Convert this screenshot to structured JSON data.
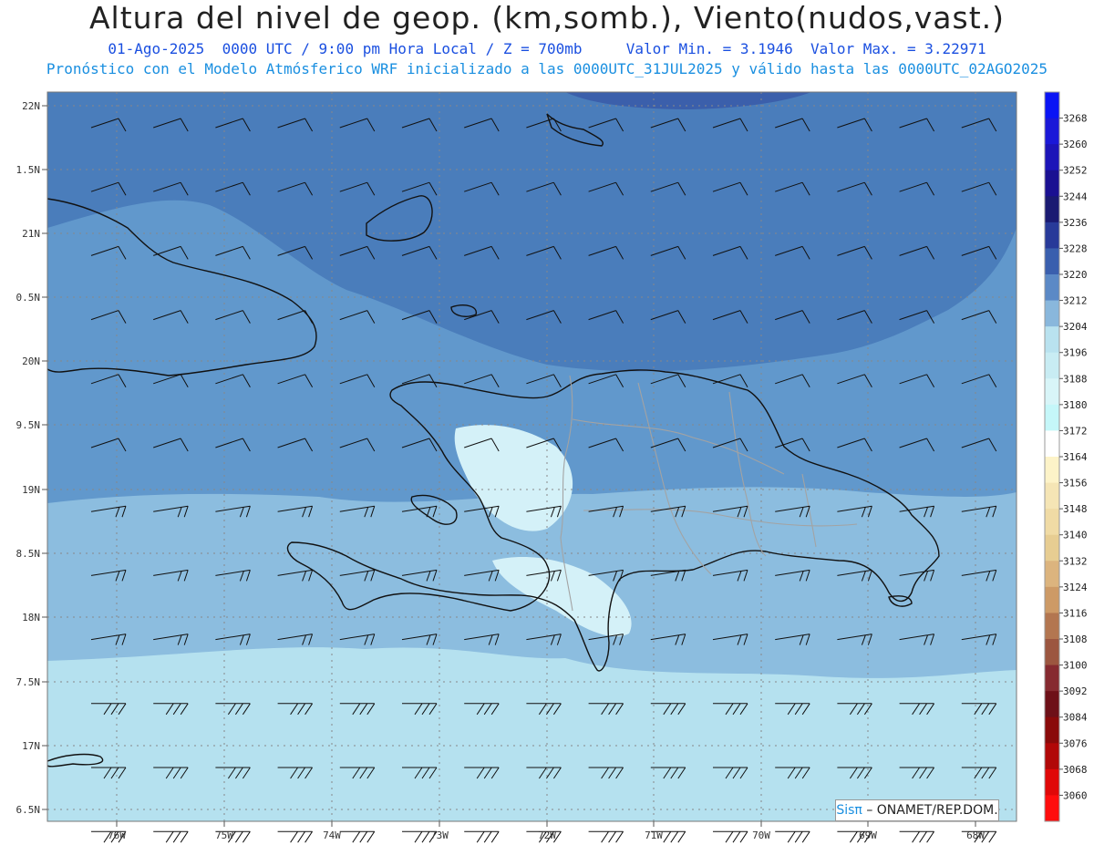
{
  "header": {
    "title": "Altura del nivel de geop. (km,somb.), Viento(nudos,vast.)",
    "line1_date": "01-Ago-2025",
    "line1_time": "0000 UTC / 9:00 pm Hora Local / Z = 700mb",
    "line1_min": "Valor Min. = 3.1946",
    "line1_max": "Valor Max. = 3.22971",
    "line2": "Pronóstico con el Modelo Atmósferico WRF inicializado a las 0000UTC_31JUL2025 y válido hasta las 0000UTC_02AGO2025"
  },
  "map": {
    "lat_labels": [
      "22N",
      "1.5N",
      "21N",
      "0.5N",
      "20N",
      "9.5N",
      "19N",
      "8.5N",
      "18N",
      "7.5N",
      "17N",
      "6.5N"
    ],
    "lon_labels": [
      "76W",
      "75W",
      "74W",
      "73W",
      "72W",
      "71W",
      "70W",
      "69W",
      "68W"
    ],
    "fill_colors": {
      "deep": "#3b5fab",
      "north": "#4a7dbb",
      "band3212": "#6198cc",
      "band3204": "#8cbddf",
      "south": "#b5e1ef",
      "pale": "#d4f1f8",
      "coast": "#111111",
      "border": "#a3a3a3"
    }
  },
  "colorbar": {
    "levels": [
      "3268",
      "3260",
      "3252",
      "3244",
      "3236",
      "3228",
      "3220",
      "3212",
      "3204",
      "3196",
      "3188",
      "3180",
      "3172",
      "3164",
      "3156",
      "3148",
      "3140",
      "3132",
      "3124",
      "3116",
      "3108",
      "3100",
      "3092",
      "3084",
      "3076",
      "3068",
      "3060"
    ],
    "colors": [
      "#0a14f5",
      "#1a18d8",
      "#1c14b8",
      "#1a1092",
      "#1a1a72",
      "#283a99",
      "#3a5fae",
      "#5b89c6",
      "#89b7dc",
      "#b9e2ef",
      "#c8ecf3",
      "#d8f5f8",
      "#c5f7f9",
      "#ffffff",
      "#fdf3c8",
      "#f5e5b5",
      "#f0dba5",
      "#e7cd92",
      "#dcb47e",
      "#cd9a66",
      "#b37650",
      "#9c5640",
      "#862a30",
      "#6e1018",
      "#8a0a0a",
      "#b10808",
      "#e00808",
      "#ff0d0d"
    ]
  },
  "credit": {
    "sis": "Sisπ",
    "rest": "– ONAMET/REP.DOM."
  }
}
